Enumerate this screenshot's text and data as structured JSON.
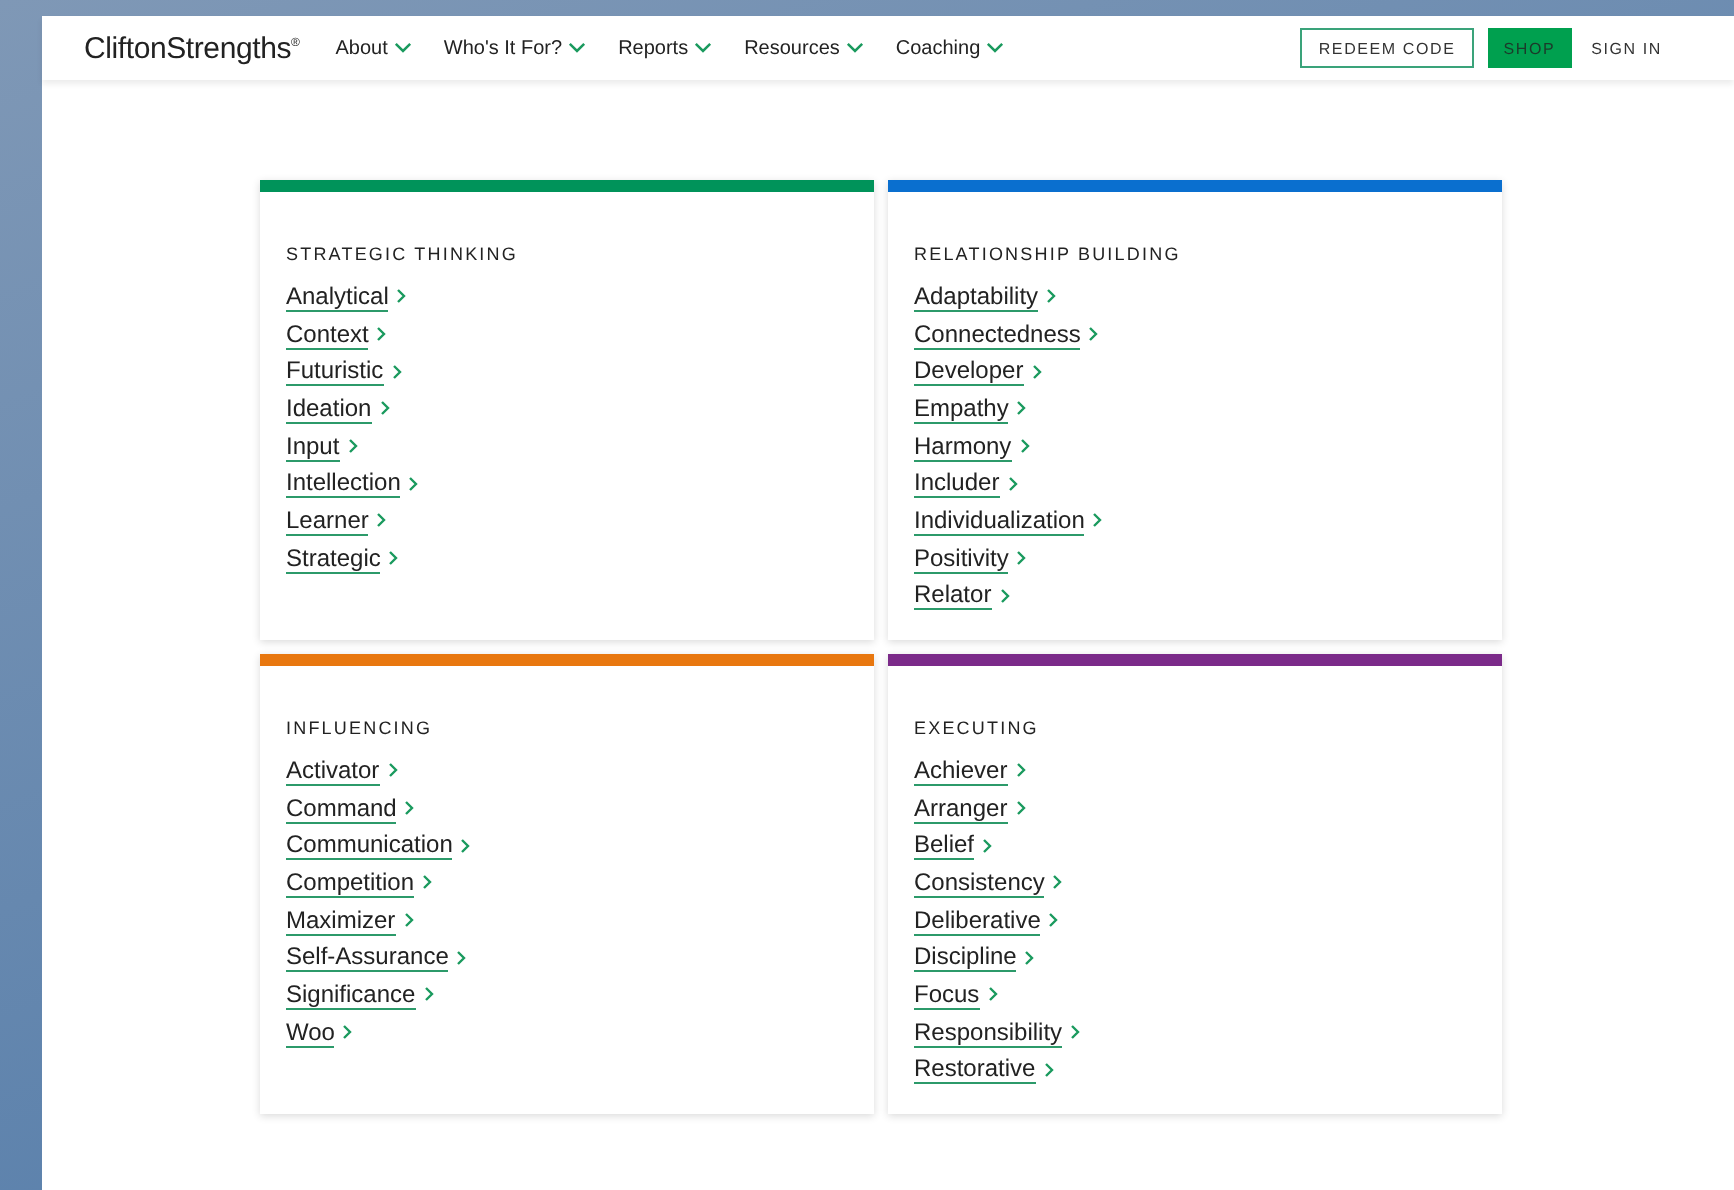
{
  "header": {
    "logo": "CliftonStrengths",
    "logo_mark": "®",
    "nav": [
      "About",
      "Who's It For?",
      "Reports",
      "Resources",
      "Coaching"
    ],
    "redeem_button": "REDEEM CODE",
    "shop_button": "SHOP",
    "sign_in": "SIGN IN"
  },
  "domains": [
    {
      "title": "STRATEGIC THINKING",
      "color": "#00935a",
      "themes": [
        "Analytical",
        "Context",
        "Futuristic",
        "Ideation",
        "Input",
        "Intellection",
        "Learner",
        "Strategic"
      ]
    },
    {
      "title": "RELATIONSHIP BUILDING",
      "color": "#0a6fcf",
      "themes": [
        "Adaptability",
        "Connectedness",
        "Developer",
        "Empathy",
        "Harmony",
        "Includer",
        "Individualization",
        "Positivity",
        "Relator"
      ]
    },
    {
      "title": "INFLUENCING",
      "color": "#e8770f",
      "themes": [
        "Activator",
        "Command",
        "Communication",
        "Competition",
        "Maximizer",
        "Self-Assurance",
        "Significance",
        "Woo"
      ]
    },
    {
      "title": "EXECUTING",
      "color": "#7b2a89",
      "themes": [
        "Achiever",
        "Arranger",
        "Belief",
        "Consistency",
        "Deliberative",
        "Discipline",
        "Focus",
        "Responsibility",
        "Restorative"
      ]
    }
  ]
}
